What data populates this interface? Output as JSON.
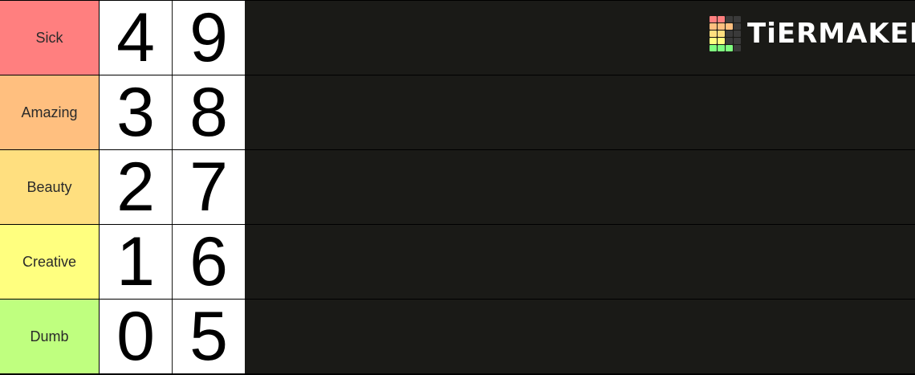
{
  "brand": {
    "name": "TiERMAKER",
    "grid_colors": [
      "#ff7f7f",
      "#ff7f7f",
      "#3a3a3a",
      "#3a3a3a",
      "#ffbf7f",
      "#ffbf7f",
      "#ffbf7f",
      "#3a3a3a",
      "#ffdf7f",
      "#ffdf7f",
      "#3a3a3a",
      "#3a3a3a",
      "#ffff7f",
      "#ffff7f",
      "#3a3a3a",
      "#3a3a3a",
      "#7fff7f",
      "#7fff7f",
      "#7fff7f",
      "#3a3a3a"
    ]
  },
  "tiers": [
    {
      "label": "Sick",
      "color": "#ff7f7f",
      "items": [
        "4",
        "9"
      ]
    },
    {
      "label": "Amazing",
      "color": "#ffbf7f",
      "items": [
        "3",
        "8"
      ]
    },
    {
      "label": "Beauty",
      "color": "#ffdf7f",
      "items": [
        "2",
        "7"
      ]
    },
    {
      "label": "Creative",
      "color": "#ffff7f",
      "items": [
        "1",
        "6"
      ]
    },
    {
      "label": "Dumb",
      "color": "#bfff7f",
      "items": [
        "0",
        "5"
      ]
    }
  ]
}
